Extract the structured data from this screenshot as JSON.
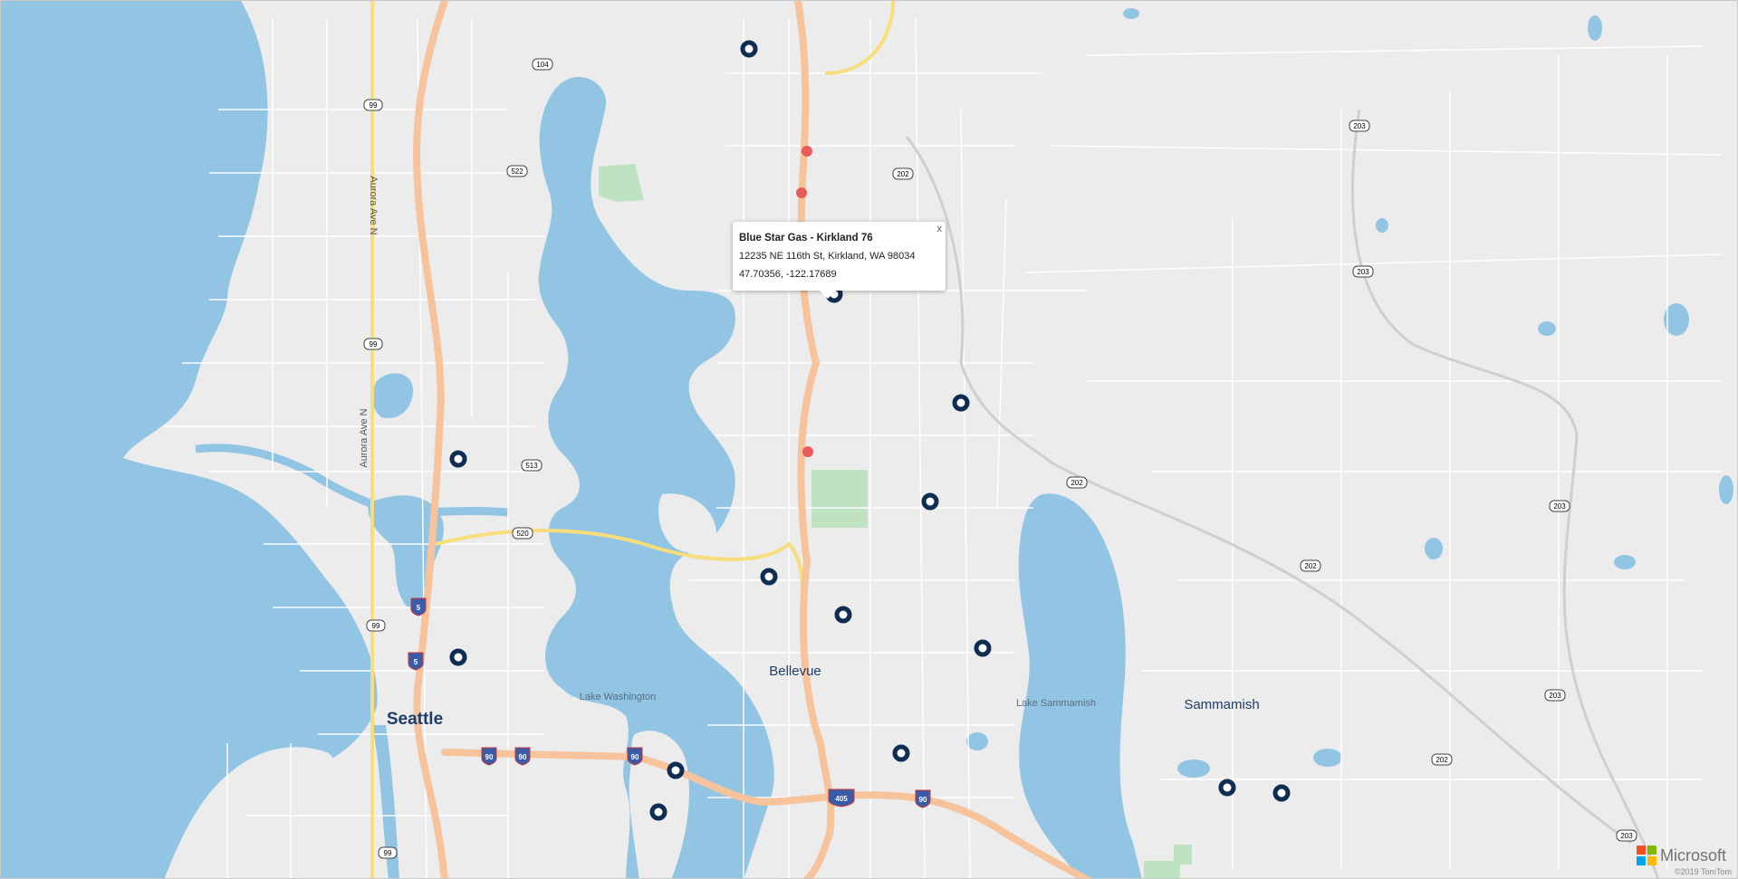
{
  "popup": {
    "title": "Blue Star Gas - Kirkland 76",
    "address": "12235 NE 116th St, Kirkland, WA 98034",
    "coordinates": "47.70356, -122.17689",
    "close_label": "x"
  },
  "places": {
    "seattle": "Seattle",
    "bellevue": "Bellevue",
    "sammamish": "Sammamish",
    "lake_washington": "Lake Washington",
    "lake_sammamish": "Lake Sammamish",
    "aurora_north": "Aurora Ave N",
    "aurora_south": "Aurora Ave N"
  },
  "shields": {
    "sr104": "104",
    "sr99a": "99",
    "sr99b": "99",
    "sr99c": "99",
    "sr99d": "99",
    "sr522": "522",
    "sr513": "513",
    "sr520": "520",
    "sr202a": "202",
    "sr202b": "202",
    "sr202c": "202",
    "sr202d": "202",
    "sr203a": "203",
    "sr203b": "203",
    "sr203c": "203",
    "sr203d": "203",
    "sr203e": "203",
    "i5a": "5",
    "i5b": "5",
    "i90a": "90",
    "i90b": "90",
    "i90c": "90",
    "i90d": "90",
    "i405": "405"
  },
  "attribution": {
    "brand": "Microsoft",
    "copyright": "©2019 TomTom"
  },
  "colors": {
    "land": "#ececec",
    "water": "#92c5e4",
    "park": "#bfe2c3",
    "freeway": "#f6c39d",
    "highway": "#f7de7a",
    "road": "#ffffff",
    "marker": "#0f2d52"
  }
}
